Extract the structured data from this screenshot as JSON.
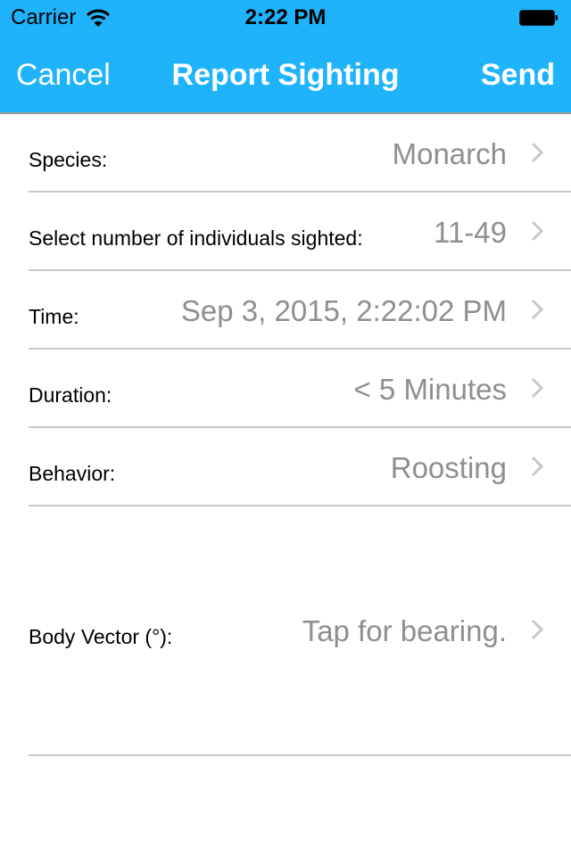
{
  "status_bar": {
    "carrier": "Carrier",
    "time": "2:22 PM",
    "icons": [
      "wifi-icon",
      "battery-icon"
    ]
  },
  "nav": {
    "cancel_label": "Cancel",
    "title": "Report Sighting",
    "send_label": "Send",
    "color": "#1fb3fb"
  },
  "form": {
    "rows": [
      {
        "label": "Species:",
        "value": "Monarch"
      },
      {
        "label": "Select number of individuals sighted:",
        "value": "11-49"
      },
      {
        "label": "Time:",
        "value": "Sep 3, 2015, 2:22:02 PM"
      },
      {
        "label": "Duration:",
        "value": "< 5 Minutes"
      },
      {
        "label": "Behavior:",
        "value": "Roosting"
      },
      {
        "label": "Body Vector (°):",
        "value": "Tap for bearing."
      }
    ]
  }
}
